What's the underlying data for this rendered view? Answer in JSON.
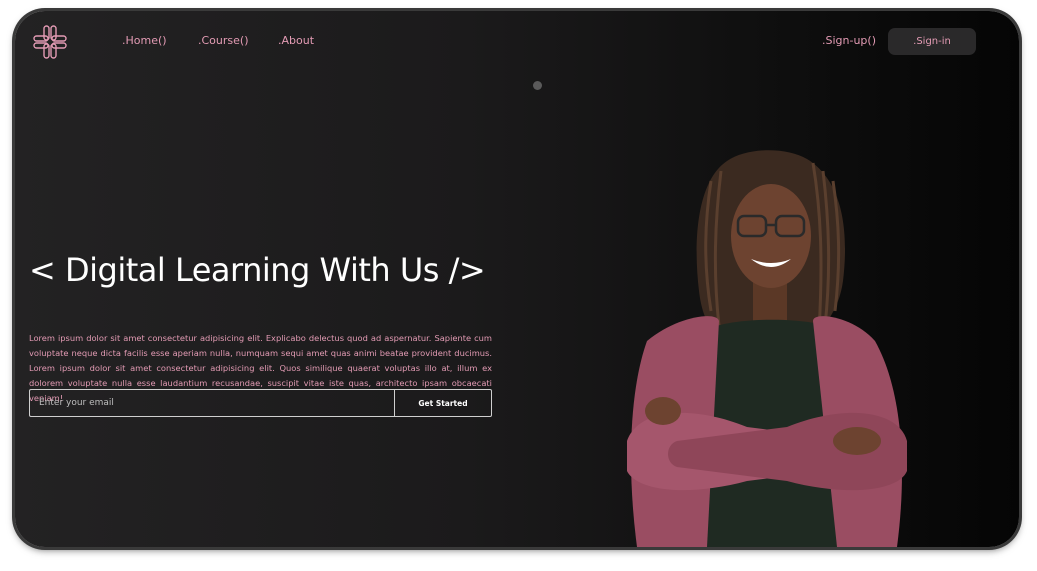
{
  "header": {
    "logo_icon": "grid-knot-logo-icon",
    "nav": {
      "home": ".Home()",
      "course": ".Course()",
      "about": ".About"
    },
    "signup": ".Sign-up()",
    "signin": ".Sign-in"
  },
  "hero": {
    "headline": "< Digital Learning With Us />",
    "body": "Lorem ipsum dolor sit amet consectetur adipisicing elit. Explicabo delectus quod ad aspernatur. Sapiente cum voluptate neque dicta facilis esse aperiam nulla, numquam sequi amet quas animi beatae provident ducimus. Lorem ipsum dolor sit amet consectetur adipisicing elit. Quos similique quaerat voluptas illo at, illum ex dolorem voluptate nulla esse laudantium recusandae, suscipit vitae iste quas, architecto ipsam obcaecati veniam!",
    "email_placeholder": "Enter your email",
    "cta": "Get Started",
    "image": "smiling-woman-arms-crossed"
  },
  "colors": {
    "accent": "#e39bb4",
    "background_dark": "#1b1a1b",
    "text_light": "#ffffff"
  }
}
